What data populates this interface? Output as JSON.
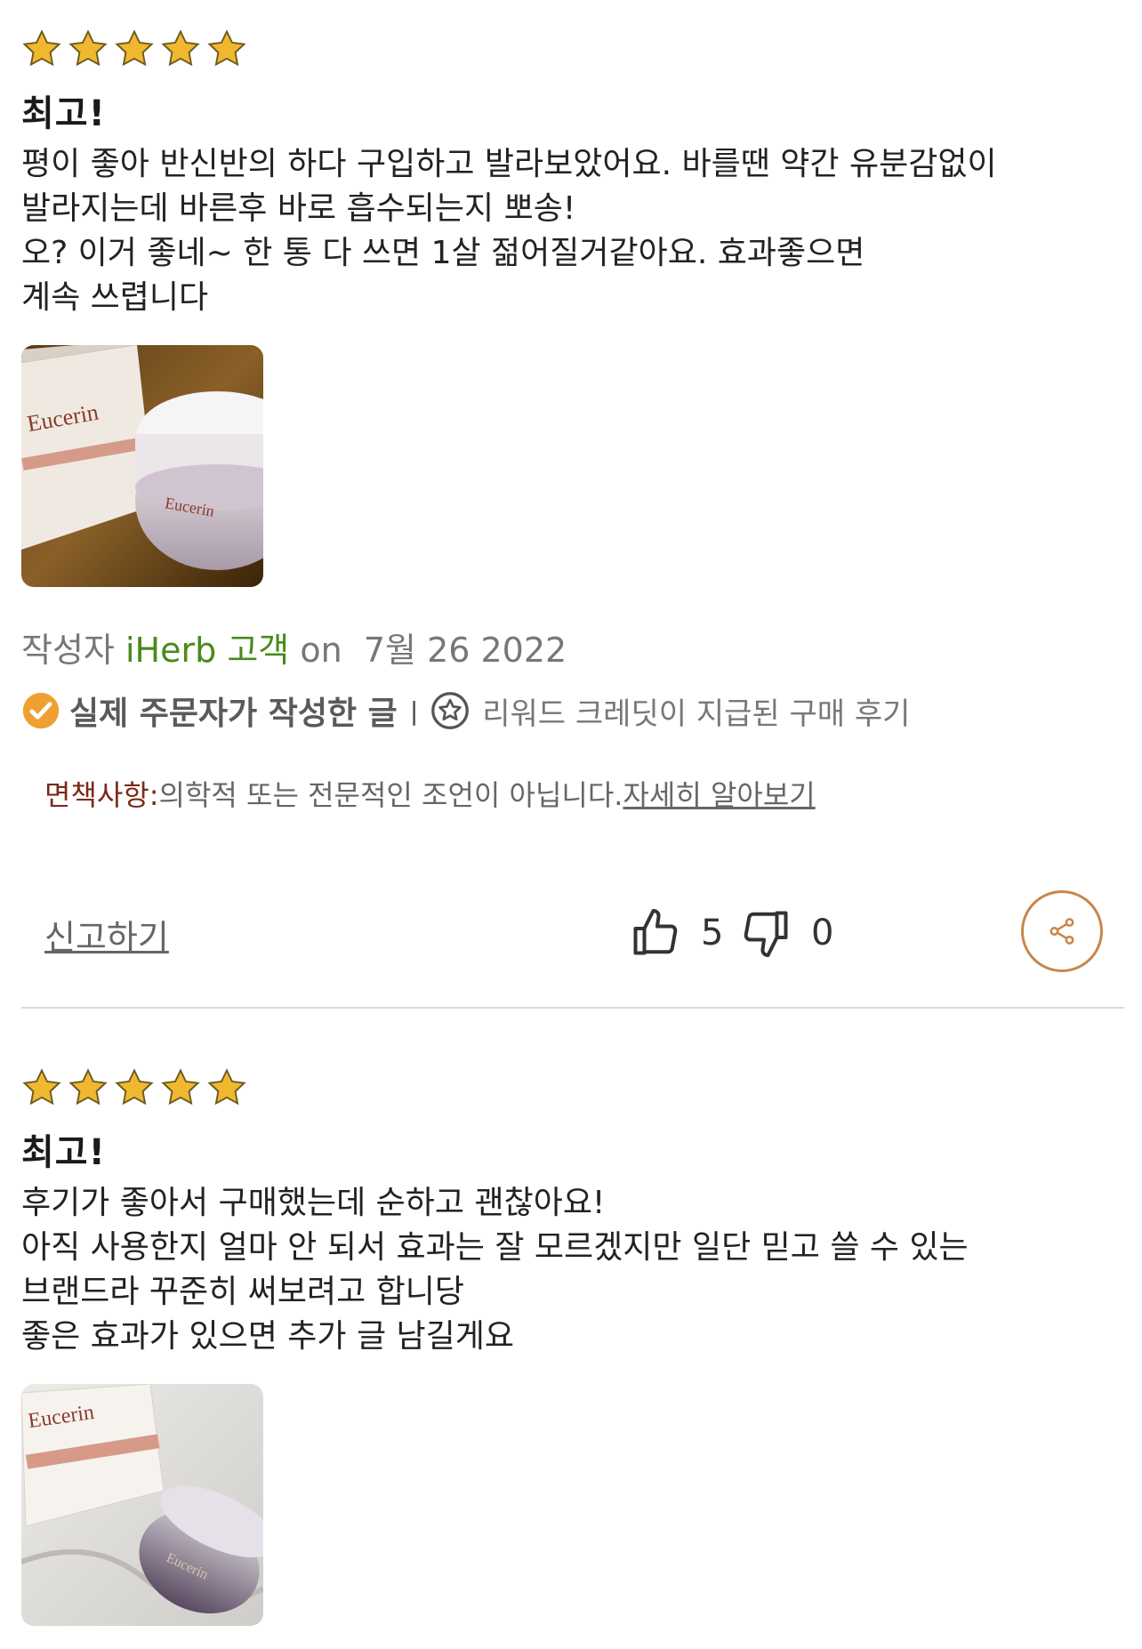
{
  "reviews": [
    {
      "rating": 5,
      "title": "최고!",
      "body": "평이 좋아 반신반의 하다 구입하고 발라보았어요. 바를땐 약간 유분감없이\n발라지는데 바른후 바로 흡수되는지 뽀송!\n오? 이거 좋네~   한 통 다 쓰면 1살 젊어질거같아요. 효과좋으면\n계속 쓰렵니다",
      "image_label": "Eucerin Q10 ANTI-WRINKLE Face Cream",
      "author_prefix": "작성자",
      "author": "iHerb 고객",
      "date_prefix": "on",
      "date": "7월 26 2022",
      "verified_label": "실제 주문자가 작성한 글",
      "separator": "|",
      "reward_label": "리워드 크레딧이 지급된 구매 후기",
      "disclaimer_label": "면책사항:",
      "disclaimer_text": "의학적 또는 전문적인 조언이 아닙니다.",
      "disclaimer_link": "자세히 알아보기",
      "report_label": "신고하기",
      "helpful_count": "5",
      "unhelpful_count": "0"
    },
    {
      "rating": 5,
      "title": "최고!",
      "body": "후기가 좋아서 구매했는데 순하고 괜찮아요!\n아직 사용한지 얼마 안 되서 효과는 잘 모르겠지만 일단 믿고 쓸 수 있는\n브랜드라 꾸준히 써보려고 합니당\n좋은 효과가 있으면  추가 글 남길게요",
      "image_label": "Eucerin Q10 ANTI-WRINKLE Face Cream"
    }
  ],
  "colors": {
    "star": "#f0b82e",
    "author": "#4a8a1c",
    "verified": "#f0a030",
    "share_border": "#c8864a",
    "disclaimer_label": "#7a2a1a"
  },
  "icons": {
    "star": "star-icon",
    "verified": "check-badge-icon",
    "reward": "reward-star-icon",
    "thumbs_up": "thumbs-up-icon",
    "thumbs_down": "thumbs-down-icon",
    "share": "share-icon"
  }
}
